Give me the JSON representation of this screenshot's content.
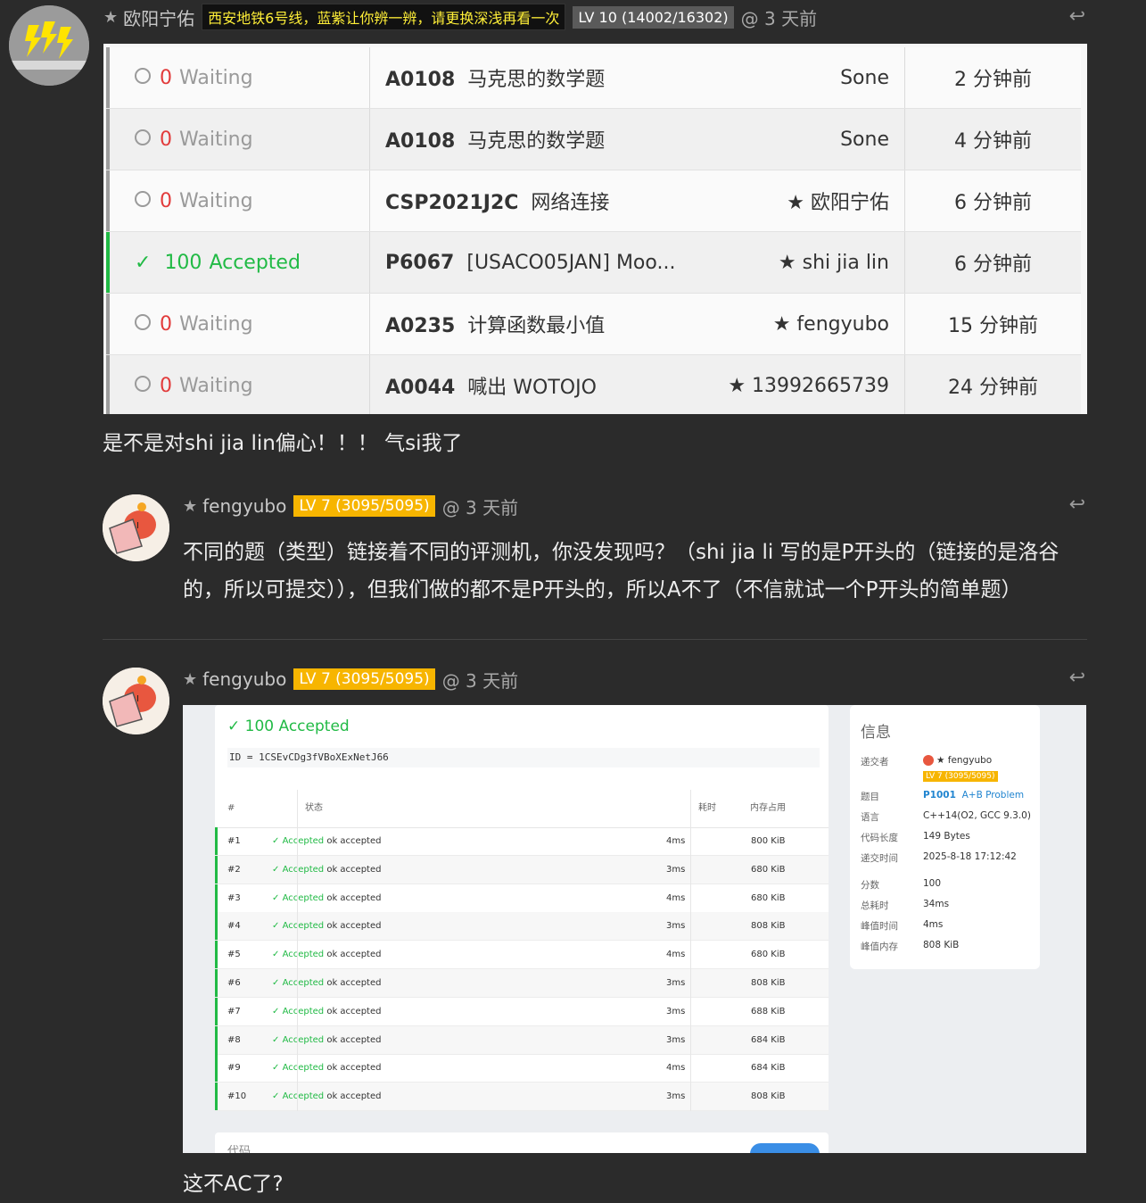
{
  "comment1": {
    "username": "欧阳宁佑",
    "tag": "西安地铁6号线，蓝紫让你辨一辨，请更换深浅再看一次",
    "level": "LV 10 (14002/16302)",
    "time": "@ 3 天前",
    "body": "是不是对shi jia lin偏心！！！  气si我了",
    "submissions": [
      {
        "score": "0",
        "status": "Waiting",
        "pid": "A0108",
        "title": "马克思的数学题",
        "user": "Sone",
        "starred": false,
        "time": "2 分钟前"
      },
      {
        "score": "0",
        "status": "Waiting",
        "pid": "A0108",
        "title": "马克思的数学题",
        "user": "Sone",
        "starred": false,
        "time": "4 分钟前"
      },
      {
        "score": "0",
        "status": "Waiting",
        "pid": "CSP2021J2C",
        "title": "网络连接",
        "user": "欧阳宁佑",
        "starred": true,
        "time": "6 分钟前"
      },
      {
        "score": "100",
        "status": "Accepted",
        "pid": "P6067",
        "title": "[USACO05JAN] Moo...",
        "user": "shi jia lin",
        "starred": true,
        "time": "6 分钟前"
      },
      {
        "score": "0",
        "status": "Waiting",
        "pid": "A0235",
        "title": "计算函数最小值",
        "user": "fengyubo",
        "starred": true,
        "time": "15 分钟前"
      },
      {
        "score": "0",
        "status": "Waiting",
        "pid": "A0044",
        "title": "喊出 WOTOJO",
        "user": "13992665739",
        "starred": true,
        "time": "24 分钟前"
      }
    ]
  },
  "comment2": {
    "username": "fengyubo",
    "level": "LV 7 (3095/5095)",
    "time": "@ 3 天前",
    "body_line1": "不同的题（类型）链接着不同的评测机，你没发现吗？（shi jia li 写的是P开头的（链接的是洛谷",
    "body_line2": "的，所以可提交）），但我们做的都不是P开头的，所以A不了（不信就试一个P开头的简单题）"
  },
  "comment3": {
    "username": "fengyubo",
    "level": "LV 7 (3095/5095)",
    "time": "@ 3 天前",
    "body": "这不AC了?",
    "record": {
      "title": "100 Accepted",
      "id_line": "ID = 1CSEvCDg3fVBoXExNetJ66",
      "headers": [
        "#",
        "状态",
        "耗时",
        "内存占用"
      ],
      "rows": [
        {
          "n": "#1",
          "status": "Accepted",
          "msg": "ok accepted",
          "time": "4ms",
          "mem": "800 KiB"
        },
        {
          "n": "#2",
          "status": "Accepted",
          "msg": "ok accepted",
          "time": "3ms",
          "mem": "680 KiB"
        },
        {
          "n": "#3",
          "status": "Accepted",
          "msg": "ok accepted",
          "time": "4ms",
          "mem": "680 KiB"
        },
        {
          "n": "#4",
          "status": "Accepted",
          "msg": "ok accepted",
          "time": "3ms",
          "mem": "808 KiB"
        },
        {
          "n": "#5",
          "status": "Accepted",
          "msg": "ok accepted",
          "time": "4ms",
          "mem": "680 KiB"
        },
        {
          "n": "#6",
          "status": "Accepted",
          "msg": "ok accepted",
          "time": "3ms",
          "mem": "808 KiB"
        },
        {
          "n": "#7",
          "status": "Accepted",
          "msg": "ok accepted",
          "time": "3ms",
          "mem": "688 KiB"
        },
        {
          "n": "#8",
          "status": "Accepted",
          "msg": "ok accepted",
          "time": "3ms",
          "mem": "684 KiB"
        },
        {
          "n": "#9",
          "status": "Accepted",
          "msg": "ok accepted",
          "time": "4ms",
          "mem": "684 KiB"
        },
        {
          "n": "#10",
          "status": "Accepted",
          "msg": "ok accepted",
          "time": "3ms",
          "mem": "808 KiB"
        }
      ],
      "code_label": "代码",
      "info": {
        "title": "信息",
        "submitter_label": "递交者",
        "submitter": "★ fengyubo",
        "submitter_level": "LV 7 (3095/5095)",
        "problem_label": "题目",
        "problem_id": "P1001",
        "problem_name": "A+B Problem",
        "lang_label": "语言",
        "lang": "C++14(O2, GCC 9.3.0)",
        "codelen_label": "代码长度",
        "codelen": "149 Bytes",
        "subtime_label": "递交时间",
        "subtime": "2025-8-18 17:12:42",
        "score_label": "分数",
        "score": "100",
        "total_time_label": "总耗时",
        "total_time": "34ms",
        "peak_time_label": "峰值时间",
        "peak_time": "4ms",
        "peak_mem_label": "峰值内存",
        "peak_mem": "808 KiB"
      }
    }
  }
}
